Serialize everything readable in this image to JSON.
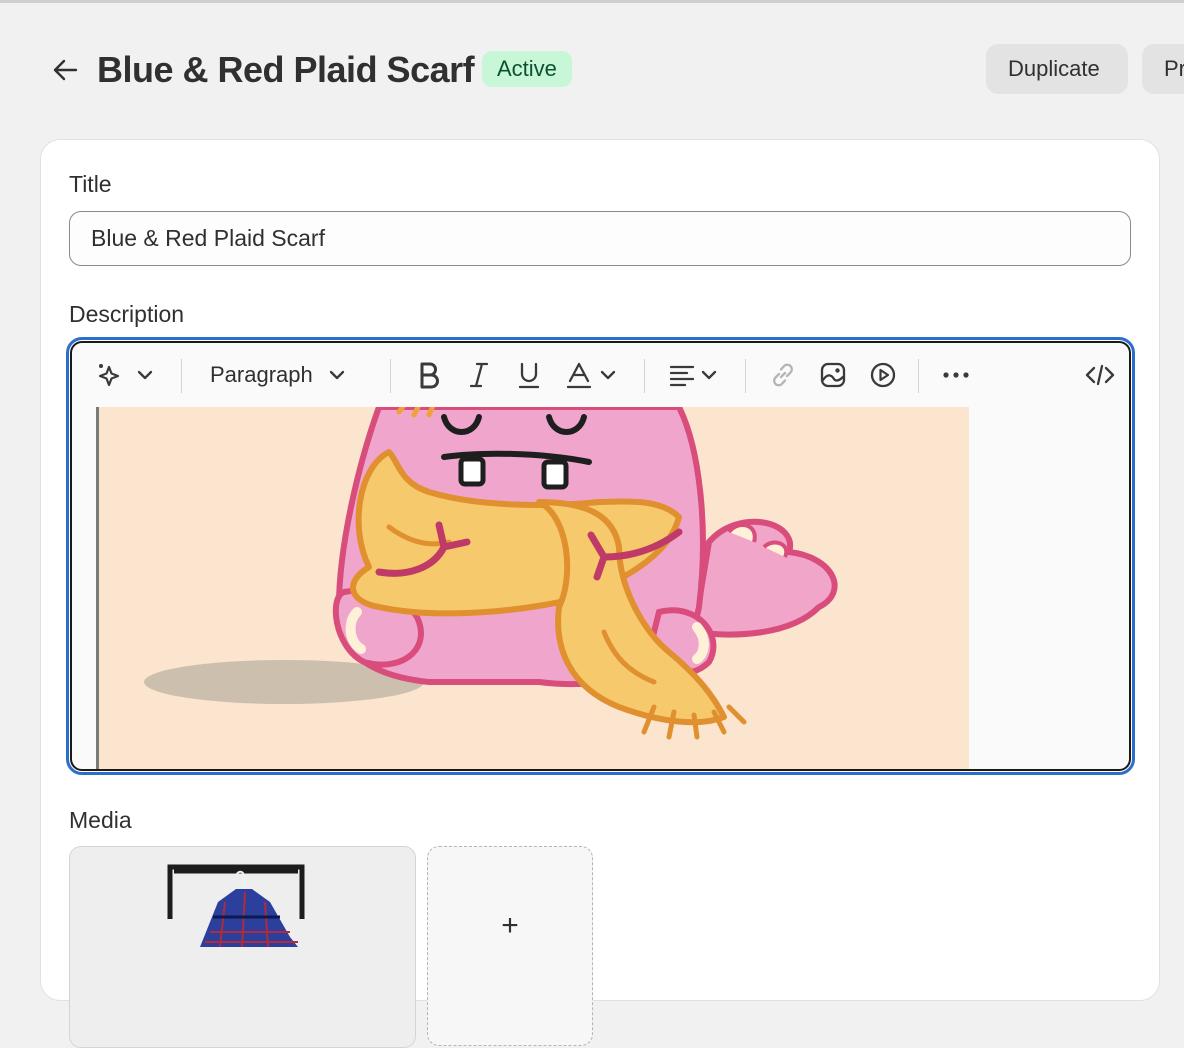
{
  "header": {
    "title": "Blue & Red Plaid Scarf",
    "status": "Active",
    "duplicate_label": "Duplicate",
    "preview_label": "Pr"
  },
  "form": {
    "title_label": "Title",
    "title_value": "Blue & Red Plaid Scarf",
    "description_label": "Description",
    "media_label": "Media"
  },
  "toolbar": {
    "block_format": "Paragraph",
    "icons": [
      "magic-icon",
      "chevron-down-icon",
      "bold-icon",
      "italic-icon",
      "underline-icon",
      "text-color-icon",
      "align-icon",
      "link-icon",
      "image-icon",
      "video-icon",
      "more-icon",
      "code-icon"
    ]
  },
  "media": {
    "add_label": "+"
  },
  "colors": {
    "background": "#f1f1f1",
    "status_bg": "#c8f7d8",
    "status_text": "#0c5132",
    "focus_ring": "#2c6ecb"
  }
}
